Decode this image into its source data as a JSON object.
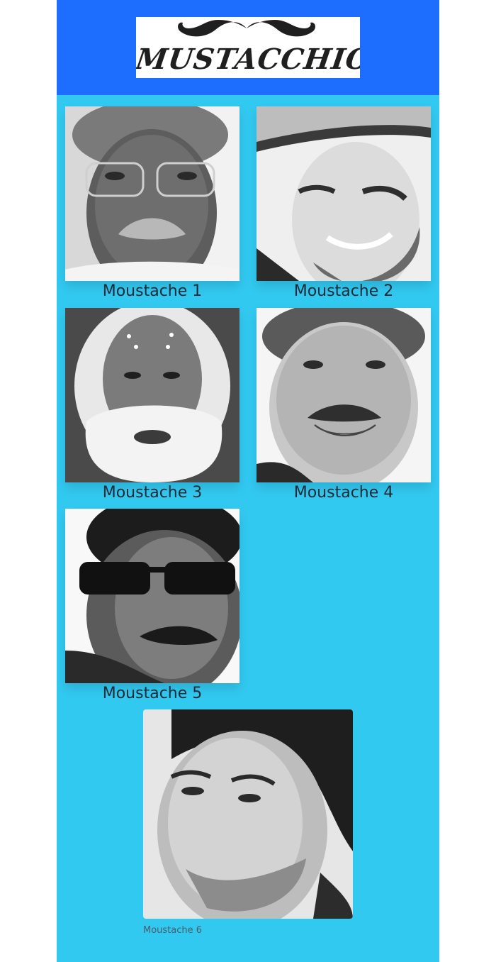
{
  "header": {
    "logo_text": "MUSTACCHIO",
    "bg_color": "#1d6dff"
  },
  "gallery": {
    "bg_color": "#32c9f1",
    "items": [
      {
        "caption": "Moustache 1"
      },
      {
        "caption": "Moustache 2"
      },
      {
        "caption": "Moustache 3"
      },
      {
        "caption": "Moustache 4"
      },
      {
        "caption": "Moustache 5"
      }
    ],
    "featured": {
      "caption": "Moustache 6"
    }
  }
}
